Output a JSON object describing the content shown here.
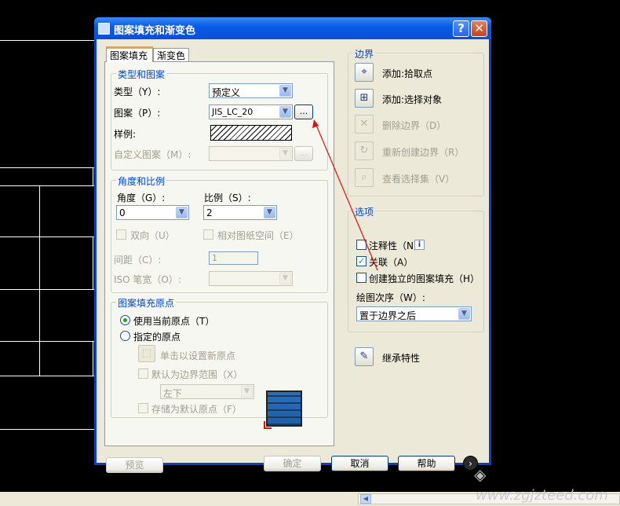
{
  "window": {
    "title": "图案填充和渐变色",
    "help_glyph": "?",
    "close_glyph": "✕"
  },
  "tabs": [
    {
      "label": "图案填充",
      "active": true
    },
    {
      "label": "渐变色",
      "active": false
    }
  ],
  "type_pattern": {
    "group_label": "类型和图案",
    "type_label": "类型（Y）:",
    "type_value": "预定义",
    "pattern_label": "图案（P）:",
    "pattern_value": "JIS_LC_20",
    "browse_label": "...",
    "sample_label": "样例:",
    "custom_label": "自定义图案（M）:",
    "custom_browse_label": "..."
  },
  "angle_scale": {
    "group_label": "角度和比例",
    "angle_label": "角度（G）:",
    "angle_value": "0",
    "scale_label": "比例（S）:",
    "scale_value": "2",
    "double_label": "双向（U）",
    "relative_label": "相对图纸空间（E）",
    "spacing_label": "间距（C）:",
    "spacing_value": "1",
    "iso_label": "ISO 笔宽（O）:"
  },
  "origin": {
    "group_label": "图案填充原点",
    "current_label": "使用当前原点（T）",
    "specified_label": "指定的原点",
    "click_set_label": "单击以设置新原点",
    "default_extent_label": "默认为边界范围（X）",
    "extent_value": "左下",
    "store_label": "存储为默认原点（F）"
  },
  "boundaries": {
    "group_label": "边界",
    "items": [
      {
        "label": "添加:拾取点",
        "icon": "pick-points-icon",
        "enabled": true
      },
      {
        "label": "添加:选择对象",
        "icon": "select-objects-icon",
        "enabled": true
      },
      {
        "label": "删除边界（D）",
        "icon": "remove-boundaries-icon",
        "enabled": false
      },
      {
        "label": "重新创建边界（R）",
        "icon": "recreate-boundary-icon",
        "enabled": false
      },
      {
        "label": "查看选择集（V）",
        "icon": "view-selections-icon",
        "enabled": false
      }
    ]
  },
  "options": {
    "group_label": "选项",
    "annotative_label": "注释性（N）",
    "annotative_info": "i",
    "associative_label": "关联（A）",
    "separate_label": "创建独立的图案填充（H）",
    "draw_order_label": "绘图次序（W）:",
    "draw_order_value": "置于边界之后"
  },
  "inherit": {
    "label": "继承特性"
  },
  "footer": {
    "preview_label": "预览",
    "ok_label": "确定",
    "cancel_label": "取消",
    "help_label": "帮助",
    "more_glyph": "›"
  },
  "watermark": "www.zgjzteed.com",
  "colors": {
    "title_blue": "#0a4fd8",
    "group_label_blue": "#0046d5",
    "check_green": "#21a121",
    "annotation_red": "#e01010"
  }
}
